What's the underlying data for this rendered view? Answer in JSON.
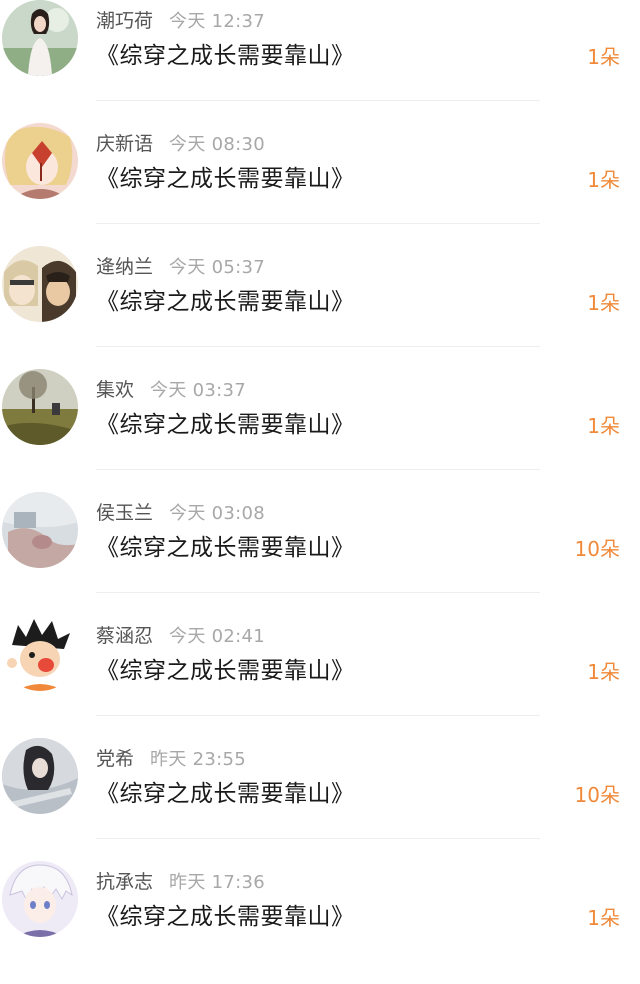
{
  "records": [
    {
      "name": "潮巧荷",
      "time": "今天  12:37",
      "book": "《综穿之成长需要靠山》",
      "count": "1朵",
      "avatar_icon": "avatar-woman-photo"
    },
    {
      "name": "庆新语",
      "time": "今天  08:30",
      "book": "《综穿之成长需要靠山》",
      "count": "1朵",
      "avatar_icon": "avatar-anime-girl-leaf"
    },
    {
      "name": "逄纳兰",
      "time": "今天  05:37",
      "book": "《综穿之成长需要靠山》",
      "count": "1朵",
      "avatar_icon": "avatar-anime-duo"
    },
    {
      "name": "集欢",
      "time": "今天  03:37",
      "book": "《综穿之成长需要靠山》",
      "count": "1朵",
      "avatar_icon": "avatar-landscape-tree"
    },
    {
      "name": "侯玉兰",
      "time": "今天  03:08",
      "book": "《综穿之成长需要靠山》",
      "count": "10朵",
      "avatar_icon": "avatar-blurred-photo"
    },
    {
      "name": "蔡涵忍",
      "time": "今天  02:41",
      "book": "《综穿之成长需要靠山》",
      "count": "1朵",
      "avatar_icon": "avatar-cartoon-boy"
    },
    {
      "name": "党希",
      "time": "昨天  23:55",
      "book": "《综穿之成长需要靠山》",
      "count": "10朵",
      "avatar_icon": "avatar-girl-text-overlay"
    },
    {
      "name": "抗承志",
      "time": "昨天  17:36",
      "book": "《综穿之成长需要靠山》",
      "count": "1朵",
      "avatar_icon": "avatar-anime-white-hair"
    }
  ],
  "colors": {
    "name": "#555555",
    "time": "#a8a8a8",
    "book": "#1a1a1a",
    "count_accent": "#f08a3a",
    "divider": "#eeeeee"
  }
}
